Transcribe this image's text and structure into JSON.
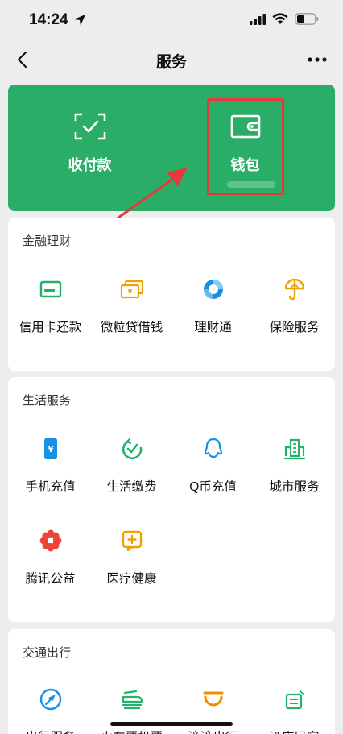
{
  "status_bar": {
    "time": "14:24"
  },
  "nav": {
    "title": "服务"
  },
  "hero": {
    "items": [
      {
        "label": "收付款",
        "icon": "scan-pay-icon"
      },
      {
        "label": "钱包",
        "icon": "wallet-icon"
      }
    ],
    "accent": "#2aae67"
  },
  "finance": {
    "title": "金融理财",
    "items": [
      {
        "label": "信用卡还款",
        "icon": "credit-card-icon"
      },
      {
        "label": "微粒贷借钱",
        "icon": "loan-icon"
      },
      {
        "label": "理财通",
        "icon": "wealth-icon"
      },
      {
        "label": "保险服务",
        "icon": "insurance-icon"
      }
    ]
  },
  "life": {
    "title": "生活服务",
    "items": [
      {
        "label": "手机充值",
        "icon": "phone-topup-icon"
      },
      {
        "label": "生活缴费",
        "icon": "utility-payment-icon"
      },
      {
        "label": "Q币充值",
        "icon": "qcoin-icon"
      },
      {
        "label": "城市服务",
        "icon": "city-services-icon"
      },
      {
        "label": "腾讯公益",
        "icon": "charity-icon"
      },
      {
        "label": "医疗健康",
        "icon": "medical-icon"
      }
    ]
  },
  "travel": {
    "title": "交通出行",
    "items": [
      {
        "label": "出行服务",
        "icon": "travel-icon"
      },
      {
        "label": "火车票机票",
        "icon": "train-ticket-icon"
      },
      {
        "label": "滴滴出行",
        "icon": "didi-icon"
      },
      {
        "label": "酒店民宿",
        "icon": "hotel-icon"
      }
    ]
  }
}
